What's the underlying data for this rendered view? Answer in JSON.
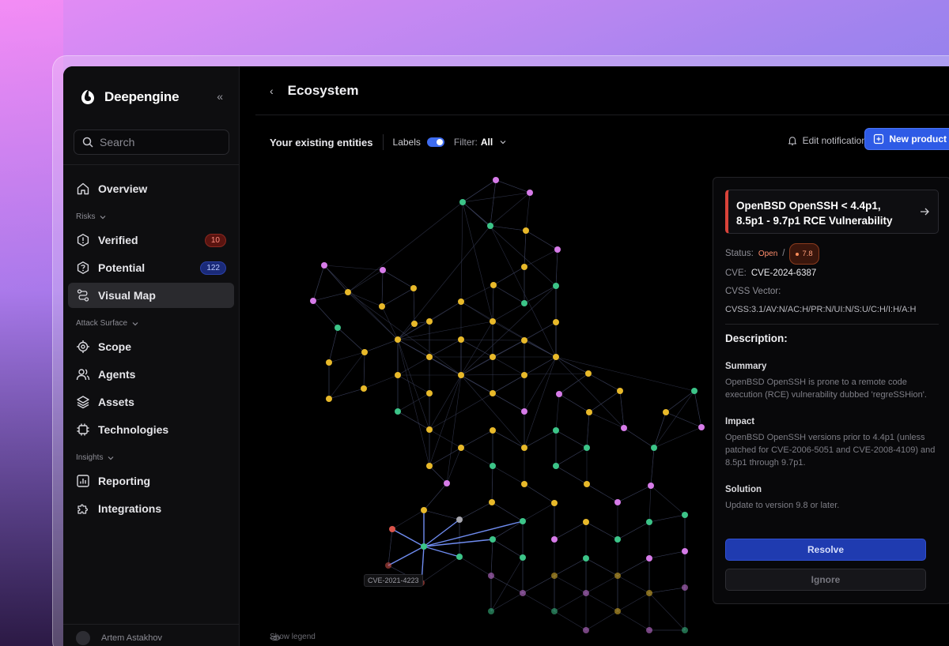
{
  "brand": {
    "name": "Deepengine"
  },
  "search": {
    "placeholder": "Search"
  },
  "sidebar": {
    "overview": "Overview",
    "risks_section": "Risks",
    "verified": {
      "label": "Verified",
      "count": "10"
    },
    "potential": {
      "label": "Potential",
      "count": "122"
    },
    "visual_map": "Visual Map",
    "attack_surface_section": "Attack Surface",
    "scope": "Scope",
    "agents": "Agents",
    "assets": "Assets",
    "technologies": "Technologies",
    "insights_section": "Insights",
    "reporting": "Reporting",
    "integrations": "Integrations",
    "user_name": "Artem Astakhov"
  },
  "header": {
    "title": "Ecosystem"
  },
  "toolbar": {
    "entities": "Your existing entities",
    "labels": "Labels",
    "labels_on": true,
    "filter_label": "Filter:",
    "filter_value": "All",
    "edit_notifications": "Edit notifications",
    "new_product": "New product"
  },
  "graph": {
    "tooltip": "CVE-2021-4223",
    "show_legend": "Show legend",
    "colors": {
      "pink": "#d67be8",
      "yellow": "#e8b92a",
      "green": "#3cc488",
      "red": "#d9544a",
      "gray": "#a8a8b0",
      "edge": "#3a3f5a",
      "highlight": "#6f8cf0"
    }
  },
  "panel": {
    "title": "OpenBSD OpenSSH < 4.4p1, 8.5p1 - 9.7p1 RCE Vulnerability",
    "status_label": "Status:",
    "status_value": "Open",
    "status_sep": "/",
    "score": "7.8",
    "cve_label": "CVE:",
    "cve_value": "CVE-2024-6387",
    "cvss_label": "CVSS Vector:",
    "cvss_value": "CVSS:3.1/AV:N/AC:H/PR:N/UI:N/S:U/C:H/I:H/A:H",
    "description_heading": "Description:",
    "summary_heading": "Summary",
    "summary_text": "OpenBSD OpenSSH is prone to a remote code execution (RCE) vulnerability dubbed 'regreSSHion'.",
    "impact_heading": "Impact",
    "impact_text": "OpenBSD OpenSSH versions prior to 4.4p1 (unless patched for CVE-2006-5051 and CVE-2008-4109) and 8.5p1 through 9.7p1.",
    "solution_heading": "Solution",
    "solution_text": "Update to version 9.8 or later.",
    "resolve": "Resolve",
    "ignore": "Ignore"
  }
}
